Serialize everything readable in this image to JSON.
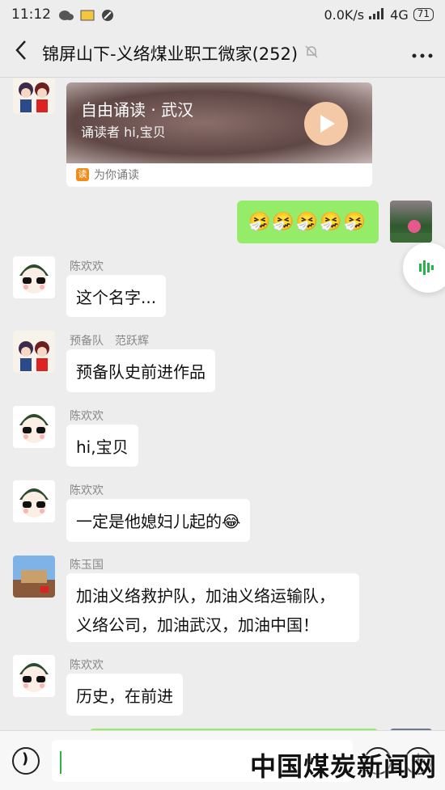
{
  "status_bar": {
    "time": "11:12",
    "network_speed": "0.0K/s",
    "network_type": "4G",
    "battery": "71"
  },
  "header": {
    "back_icon": "chevron-left-icon",
    "title": "锦屏山下-义络煤业职工微家(252)",
    "mute_icon": "bell-off-icon",
    "more_icon": "more-dots-icon"
  },
  "messages": {
    "share_card": {
      "title": "自由诵读 · 武汉",
      "subtitle": "诵读者 hi,宝贝",
      "footer": "为你诵读",
      "footer_badge": "读"
    },
    "mine": {
      "text": "🤧🤧🤧🤧🤧"
    },
    "m1": {
      "sender": "陈欢欢",
      "text": "这个名字..."
    },
    "m2": {
      "sender": "预备队　范跃辉",
      "text": "预备队史前进作品"
    },
    "m3": {
      "sender": "陈欢欢",
      "text": "hi,宝贝"
    },
    "m4": {
      "sender": "陈欢欢",
      "text": "一定是他媳妇儿起的😂"
    },
    "m5": {
      "sender": "陈玉国",
      "line1": "加油义络救护队，加油义络运输队，",
      "line2": "义络公司，加油武汉，加油中国！"
    },
    "m6": {
      "sender": "陈欢欢",
      "text": "历史，在前进"
    }
  },
  "watermark": "中国煤炭新闻网",
  "colors": {
    "my_bubble": "#95ec69",
    "caret": "#2bb24c",
    "background": "#ededed"
  }
}
